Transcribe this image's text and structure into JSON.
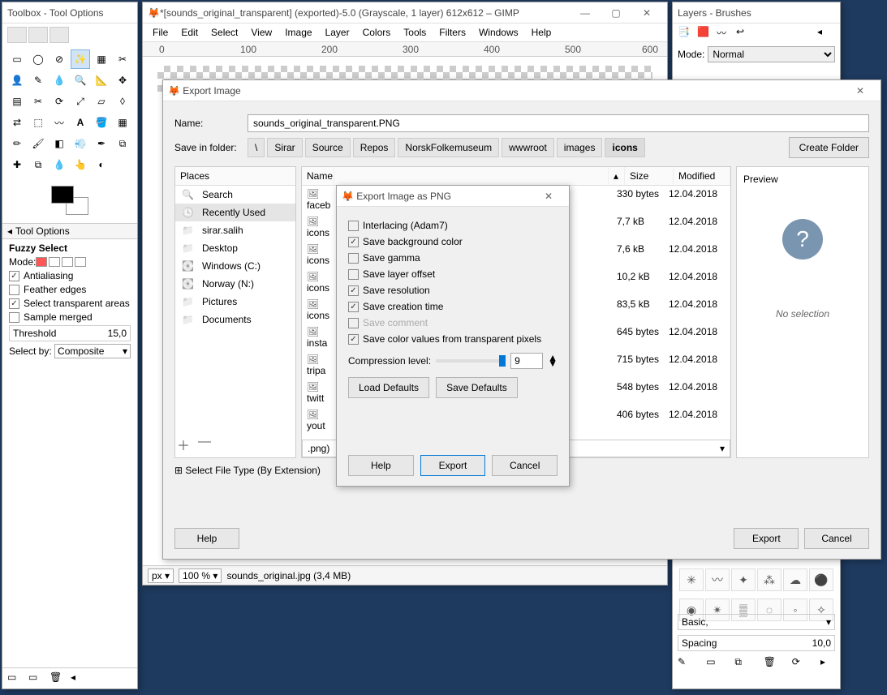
{
  "toolbox": {
    "title": "Toolbox - Tool Options",
    "options_header": "Tool Options",
    "tool_name": "Fuzzy Select",
    "mode_label": "Mode:",
    "antialias": "Antialiasing",
    "feather": "Feather edges",
    "select_transparent": "Select transparent areas",
    "sample_merged": "Sample merged",
    "threshold_label": "Threshold",
    "threshold_value": "15,0",
    "select_by_label": "Select by:",
    "select_by_value": "Composite"
  },
  "gimp": {
    "title": "*[sounds_original_transparent] (exported)-5.0 (Grayscale, 1 layer) 612x612 – GIMP",
    "menu": [
      "File",
      "Edit",
      "Select",
      "View",
      "Image",
      "Layer",
      "Colors",
      "Tools",
      "Filters",
      "Windows",
      "Help"
    ],
    "ruler_ticks": [
      "0",
      "100",
      "200",
      "300",
      "400",
      "500",
      "600"
    ],
    "unit": "px",
    "zoom": "100 %",
    "status": "sounds_original.jpg (3,4 MB)"
  },
  "layers": {
    "title": "Layers - Brushes",
    "mode_label": "Mode:",
    "mode_value": "Normal",
    "basic_label": "Basic,",
    "spacing_label": "Spacing",
    "spacing_value": "10,0"
  },
  "export": {
    "title": "Export Image",
    "name_label": "Name:",
    "name_value": "sounds_original_transparent.PNG",
    "save_in_label": "Save in folder:",
    "crumbs": [
      "\\",
      "Sirar",
      "Source",
      "Repos",
      "NorskFolkemuseum",
      "wwwroot",
      "images",
      "icons"
    ],
    "create_folder": "Create Folder",
    "places_header": "Places",
    "places": [
      {
        "label": "Search",
        "kind": "mag"
      },
      {
        "label": "Recently Used",
        "kind": "clock",
        "sel": true
      },
      {
        "label": "sirar.salih",
        "kind": "folder"
      },
      {
        "label": "Desktop",
        "kind": "folder"
      },
      {
        "label": "Windows (C:)",
        "kind": "disk"
      },
      {
        "label": "Norway (N:)",
        "kind": "disk"
      },
      {
        "label": "Pictures",
        "kind": "folder"
      },
      {
        "label": "Documents",
        "kind": "folder"
      }
    ],
    "cols": {
      "name": "Name",
      "size": "Size",
      "modified": "Modified"
    },
    "files": [
      {
        "name": "faceb",
        "size": "330 bytes",
        "mod": "12.04.2018"
      },
      {
        "name": "icons",
        "size": "7,7 kB",
        "mod": "12.04.2018"
      },
      {
        "name": "icons",
        "size": "7,6 kB",
        "mod": "12.04.2018"
      },
      {
        "name": "icons",
        "size": "10,2 kB",
        "mod": "12.04.2018"
      },
      {
        "name": "icons",
        "size": "83,5 kB",
        "mod": "12.04.2018"
      },
      {
        "name": "insta",
        "size": "645 bytes",
        "mod": "12.04.2018"
      },
      {
        "name": "tripa",
        "size": "715 bytes",
        "mod": "12.04.2018"
      },
      {
        "name": "twitt",
        "size": "548 bytes",
        "mod": "12.04.2018"
      },
      {
        "name": "yout",
        "size": "406 bytes",
        "mod": "12.04.2018"
      }
    ],
    "preview_header": "Preview",
    "preview_text": "No selection",
    "ext_text": ".png)",
    "filetype_label": "Select File Type (By Extension)",
    "help": "Help",
    "export_btn": "Export",
    "cancel": "Cancel"
  },
  "png": {
    "title": "Export Image as PNG",
    "opts": [
      {
        "label": "Interlacing (Adam7)",
        "checked": false
      },
      {
        "label": "Save background color",
        "checked": true
      },
      {
        "label": "Save gamma",
        "checked": false
      },
      {
        "label": "Save layer offset",
        "checked": false
      },
      {
        "label": "Save resolution",
        "checked": true
      },
      {
        "label": "Save creation time",
        "checked": true
      },
      {
        "label": "Save comment",
        "checked": false,
        "disabled": true
      },
      {
        "label": "Save color values from transparent pixels",
        "checked": true
      }
    ],
    "compression_label": "Compression level:",
    "compression_value": "9",
    "load_defaults": "Load Defaults",
    "save_defaults": "Save Defaults",
    "help": "Help",
    "export": "Export",
    "cancel": "Cancel"
  }
}
